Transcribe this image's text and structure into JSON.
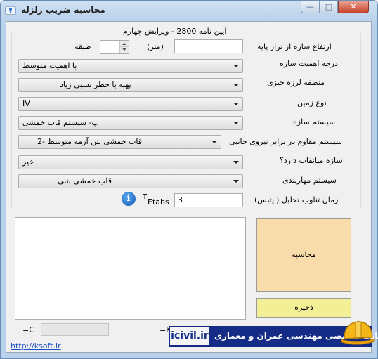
{
  "window": {
    "title": "محاسبه ضریب زلزله"
  },
  "group": {
    "legend": "آیین نامه 2800 - ویرایش چهارم"
  },
  "form": {
    "height_label": "ارتفاع سازه از تراز پایه",
    "height_value": "",
    "height_unit": "(متر)",
    "floors_label": "طبقه",
    "floors_value": "",
    "importance_label": "درجه اهمیت سازه",
    "importance_value": "با اهمیت متوسط",
    "seismic_zone_label": "منطقه لرزه خیزی",
    "seismic_zone_value": "پهنه با خطر نسبی زیاد",
    "soil_label": "نوع زمین",
    "soil_value": "IV",
    "system_label": "سیستم سازه",
    "system_value": "پ- سیستم قاب خمشی",
    "lateral_label": "سیستم مقاوم در برابر نیروی جانبی",
    "lateral_value": "قاب خمشی بتن آرمه متوسط -2",
    "soft_story_label": "سازه میانقاب دارد؟",
    "soft_story_value": "خیر",
    "bracing_label": "سیستم مهاربندی",
    "bracing_value": "قاب خمشی بتنی",
    "period_label": "زمان تناوب تحلیل  (ایتبس)",
    "period_symbol": "T",
    "period_sub": "Etabs",
    "period_value": "3"
  },
  "buttons": {
    "calculate": "محاسبه",
    "save": "ذخیره"
  },
  "results": {
    "c_label": "C=",
    "k_label": "K="
  },
  "footer": {
    "link": "http://ksoft.ir",
    "banner_site": "icivil.ir",
    "banner_text": "سایت تخصصی مهندسی عمران و معماری"
  },
  "icons": {
    "app": "earthquake-app-icon",
    "info": "info-icon",
    "helmet": "helmet-icon"
  }
}
